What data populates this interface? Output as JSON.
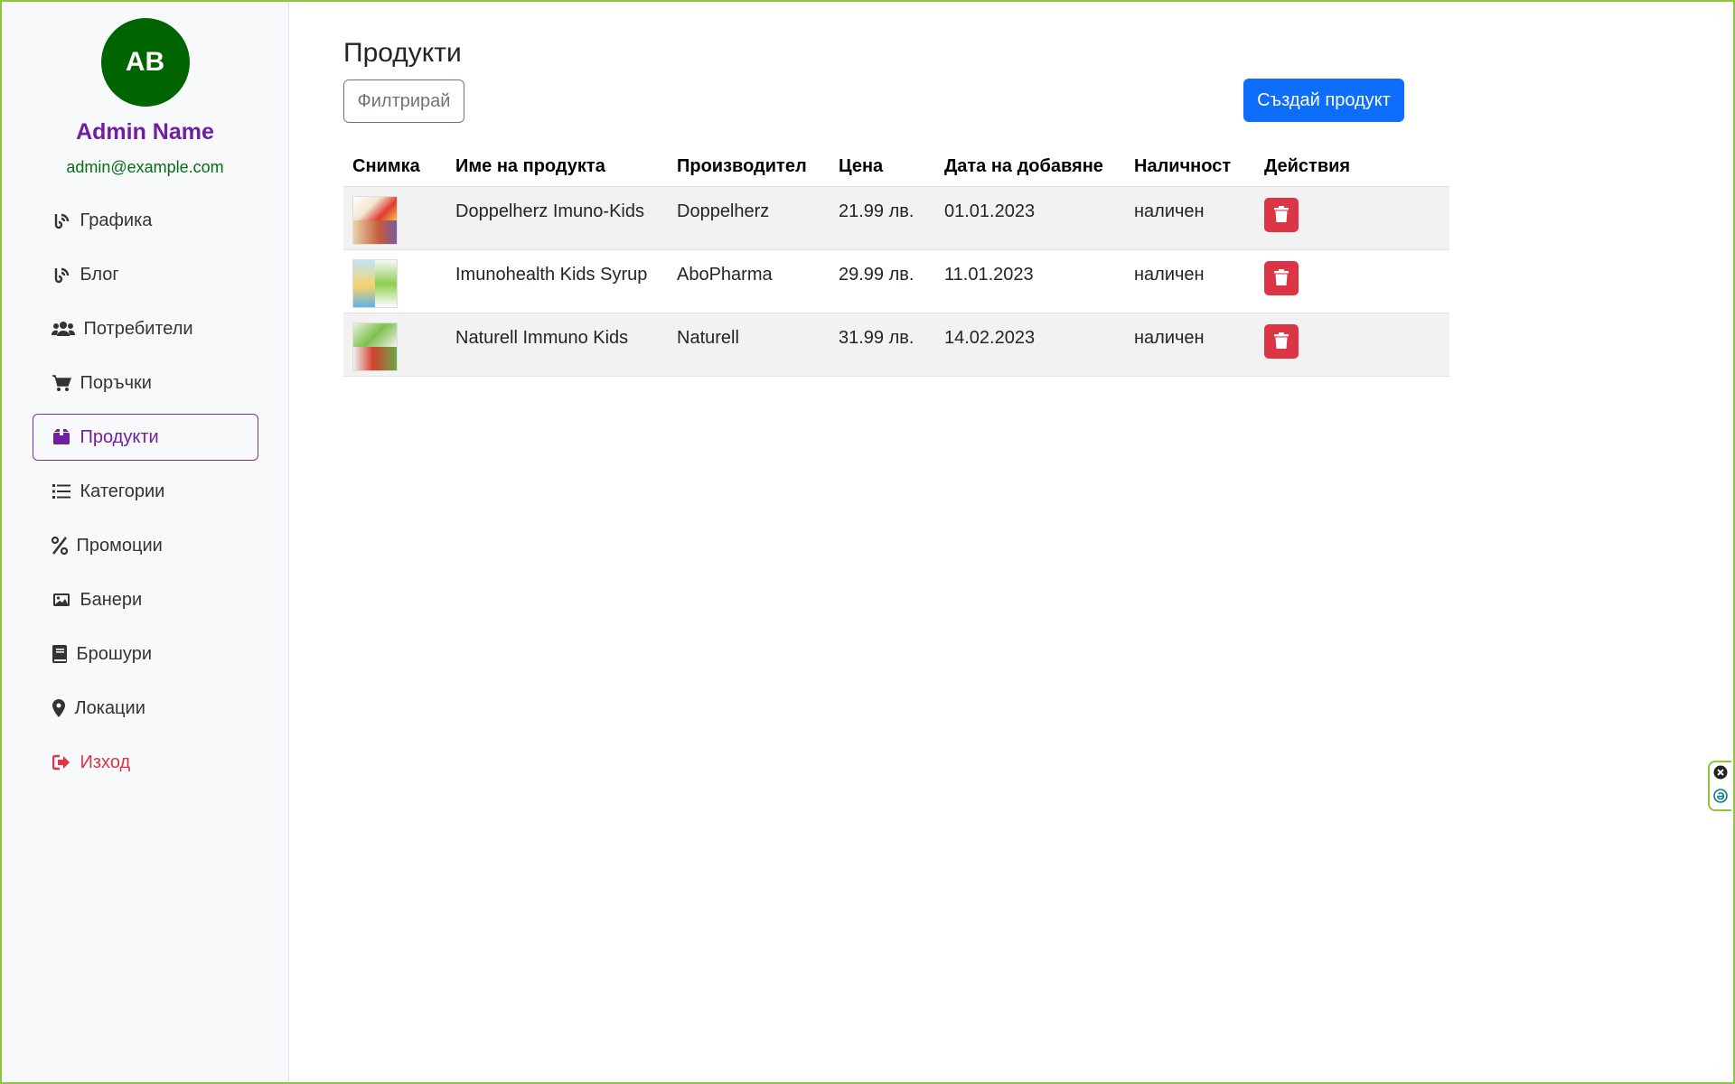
{
  "sidebar": {
    "avatar_initials": "AB",
    "admin_name": "Admin Name",
    "admin_email": "admin@example.com",
    "items": [
      {
        "label": "Графика",
        "icon": "blog-icon"
      },
      {
        "label": "Блог",
        "icon": "blog-icon"
      },
      {
        "label": "Потребители",
        "icon": "users-icon"
      },
      {
        "label": "Поръчки",
        "icon": "cart-icon"
      },
      {
        "label": "Продукти",
        "icon": "box-icon",
        "active": true
      },
      {
        "label": "Категории",
        "icon": "list-icon"
      },
      {
        "label": "Промоции",
        "icon": "percent-icon"
      },
      {
        "label": "Банери",
        "icon": "image-icon"
      },
      {
        "label": "Брошури",
        "icon": "book-icon"
      },
      {
        "label": "Локации",
        "icon": "location-pin-icon"
      },
      {
        "label": "Изход",
        "icon": "sign-out-icon"
      }
    ]
  },
  "main": {
    "title": "Продукти",
    "filter_label": "Филтрирай",
    "create_label": "Създай продукт",
    "table": {
      "headers": [
        "Снимка",
        "Име на продукта",
        "Производител",
        "Цена",
        "Дата на добавяне",
        "Наличност",
        "Действия"
      ],
      "rows": [
        {
          "name": "Doppelherz Imuno-Kids",
          "manufacturer": "Doppelherz",
          "price": "21.99 лв.",
          "date": "01.01.2023",
          "stock": "наличен"
        },
        {
          "name": "Imunohealth Kids Syrup",
          "manufacturer": "AboPharma",
          "price": "29.99 лв.",
          "date": "11.01.2023",
          "stock": "наличен"
        },
        {
          "name": "Naturell Immuno Kids",
          "manufacturer": "Naturell",
          "price": "31.99 лв.",
          "date": "14.02.2023",
          "stock": "наличен"
        }
      ]
    }
  },
  "colors": {
    "accent": "#0d6efd",
    "danger": "#dc3545",
    "active_nav": "#6f1f9f",
    "avatar_bg": "#006400",
    "frame_border": "#8cc63f"
  }
}
